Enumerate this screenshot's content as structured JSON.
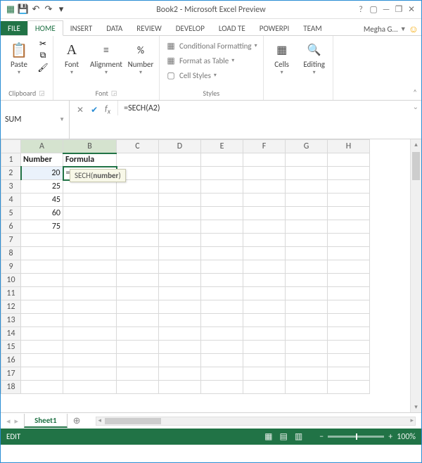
{
  "title": "Book2 - Microsoft Excel Preview",
  "user": "Megha G...",
  "tabs": {
    "file": "FILE",
    "home": "HOME",
    "insert": "INSERT",
    "data": "DATA",
    "review": "REVIEW",
    "develop": "DEVELOP",
    "loadte": "LOAD TE",
    "powerpi": "POWERPI",
    "team": "TEAM"
  },
  "ribbon": {
    "clipboard": {
      "paste": "Paste",
      "label": "Clipboard"
    },
    "font": {
      "btn": "Font",
      "label": "Font"
    },
    "alignment": {
      "btn": "Alignment"
    },
    "number": {
      "btn": "Number"
    },
    "styles": {
      "cond": "Conditional Formatting",
      "table": "Format as Table",
      "cell": "Cell Styles",
      "label": "Styles"
    },
    "cells": {
      "btn": "Cells"
    },
    "editing": {
      "btn": "Editing"
    }
  },
  "namebox": "SUM",
  "formula": "=SECH(A2)",
  "formula_prefix": "=SECH(",
  "formula_ref": "A2",
  "formula_suffix": ")",
  "tooltip_fn": "SECH",
  "tooltip_arg": "number",
  "columns": [
    "A",
    "B",
    "C",
    "D",
    "E",
    "F",
    "G",
    "H"
  ],
  "headers": {
    "a": "Number",
    "b": "Formula"
  },
  "rows": {
    "2": "20",
    "3": "25",
    "4": "45",
    "5": "60",
    "6": "75"
  },
  "row_numbers": [
    "1",
    "2",
    "3",
    "4",
    "5",
    "6",
    "7",
    "8",
    "9",
    "10",
    "11",
    "12",
    "13",
    "14",
    "15",
    "16",
    "17",
    "18"
  ],
  "sheet": "Sheet1",
  "status_mode": "EDIT",
  "zoom": "100%"
}
